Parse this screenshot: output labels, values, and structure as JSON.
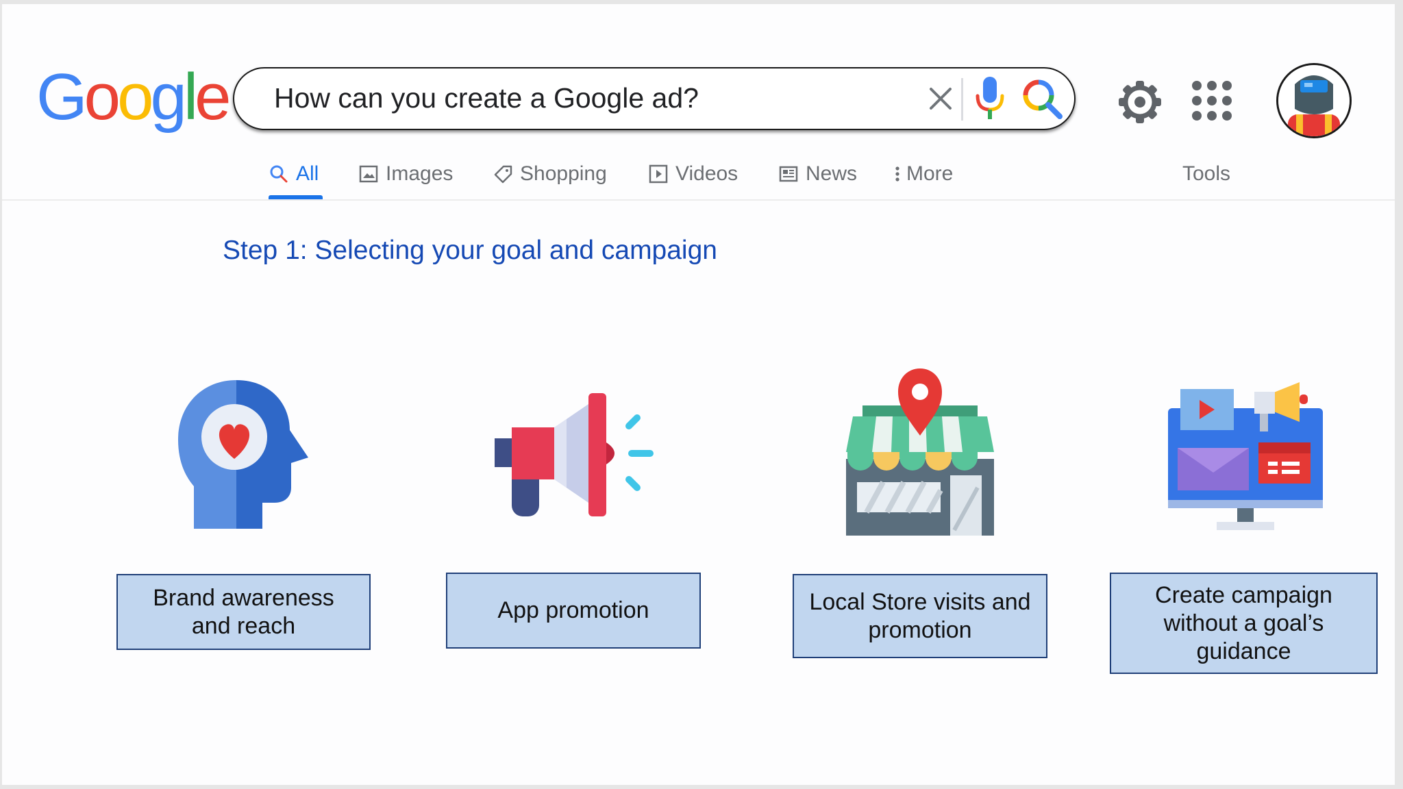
{
  "header": {
    "logo": [
      "G",
      "o",
      "o",
      "g",
      "l",
      "e"
    ],
    "logo_colors": [
      "#4285F4",
      "#EA4335",
      "#FBBC05",
      "#4285F4",
      "#34A853",
      "#EA4335"
    ],
    "search_query": "How can you create a Google ad?",
    "icons": [
      "close-icon",
      "mic-icon",
      "lens-icon",
      "gear-icon",
      "apps-icon",
      "avatar"
    ]
  },
  "tabs": [
    {
      "label": "All",
      "icon": "search-icon",
      "active": true
    },
    {
      "label": "Images",
      "icon": "image-icon"
    },
    {
      "label": "Shopping",
      "icon": "tag-icon"
    },
    {
      "label": "Videos",
      "icon": "play-icon"
    },
    {
      "label": "News",
      "icon": "news-icon"
    },
    {
      "label": "More",
      "icon": "more-vert-icon"
    }
  ],
  "tools_label": "Tools",
  "main": {
    "step_title": "Step 1: Selecting your goal and campaign",
    "goals": [
      {
        "label": "Brand awareness and reach",
        "icon": "head-heart-icon"
      },
      {
        "label": "App promotion",
        "icon": "megaphone-icon"
      },
      {
        "label": "Local Store visits and promotion",
        "icon": "store-pin-icon"
      },
      {
        "label": "Create campaign without a goal’s guidance",
        "icon": "monitor-media-icon"
      }
    ]
  },
  "colors": {
    "accent": "#1a73e8",
    "step_title": "#1549b4",
    "label_fill": "#c1d6ef",
    "label_border": "#1f3f78"
  }
}
